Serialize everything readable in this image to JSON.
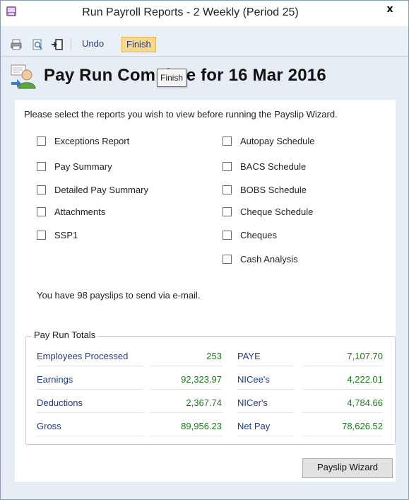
{
  "window": {
    "title": "Run Payroll Reports - 2 Weekly (Period 25)",
    "close_glyph": "x"
  },
  "toolbar": {
    "undo_label": "Undo",
    "finish_label": "Finish",
    "print_icon": "printer-icon",
    "preview_icon": "print-preview-icon",
    "export_icon": "export-icon"
  },
  "header": {
    "title": "Pay Run Complete for 16 Mar 2016",
    "tooltip": "Finish"
  },
  "instructions": "Please select the reports you wish to view before running the Payslip Wizard.",
  "reports_left": [
    {
      "label": "Exceptions Report"
    },
    {
      "label": "Pay Summary"
    },
    {
      "label": "Detailed Pay Summary"
    },
    {
      "label": "Attachments"
    },
    {
      "label": "SSP1"
    }
  ],
  "reports_right": [
    {
      "label": "Autopay Schedule"
    },
    {
      "label": "BACS Schedule"
    },
    {
      "label": "BOBS Schedule"
    },
    {
      "label": "Cheque Schedule"
    },
    {
      "label": "Cheques"
    },
    {
      "label": "Cash Analysis"
    }
  ],
  "email_message": "You have 98 payslips to send via e-mail.",
  "totals": {
    "legend": "Pay Run Totals",
    "left": [
      {
        "label": "Employees Processed",
        "value": "253"
      },
      {
        "label": "Earnings",
        "value": "92,323.97"
      },
      {
        "label": "Deductions",
        "value": "2,367.74"
      },
      {
        "label": "Gross",
        "value": "89,956.23"
      }
    ],
    "right": [
      {
        "label": "PAYE",
        "value": "7,107.70"
      },
      {
        "label": "NICee's",
        "value": "4,222.01"
      },
      {
        "label": "NICer's",
        "value": "4,784.66"
      },
      {
        "label": "Net Pay",
        "value": "78,626.52"
      }
    ]
  },
  "wizard_button": "Payslip Wizard",
  "colors": {
    "label_blue": "#1f3a8a",
    "value_green": "#1a7a1a",
    "finish_highlight": "#fcd98a"
  }
}
